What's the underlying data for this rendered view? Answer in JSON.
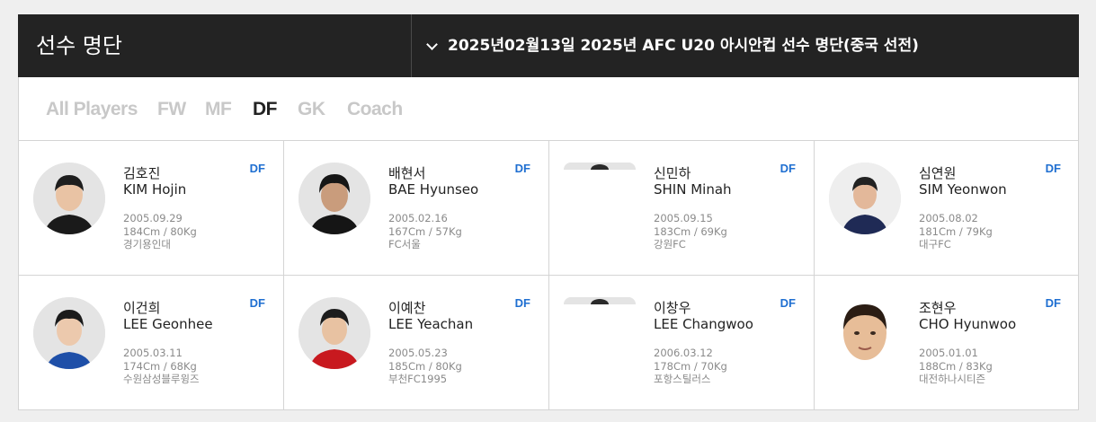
{
  "header": {
    "title": "선수 명단",
    "season": "2025년02월13일 2025년 AFC U20 아시안컵 선수 명단(중국 선전)"
  },
  "tabs": [
    "All Players",
    "FW",
    "MF",
    "DF",
    "GK",
    "Coach"
  ],
  "active_tab": "DF",
  "colors": {
    "header_bg": "#232323",
    "accent": "#1f6fd1",
    "inactive_tab": "#c8c8c8"
  },
  "players": [
    {
      "name_ko": "김호진",
      "name_en": "KIM Hojin",
      "position": "DF",
      "birth": "2005.09.29",
      "body": "184Cm / 80Kg",
      "team": "경기용인대"
    },
    {
      "name_ko": "배현서",
      "name_en": "BAE Hyunseo",
      "position": "DF",
      "birth": "2005.02.16",
      "body": "167Cm / 57Kg",
      "team": "FC서울"
    },
    {
      "name_ko": "신민하",
      "name_en": "SHIN Minah",
      "position": "DF",
      "birth": "2005.09.15",
      "body": "183Cm / 69Kg",
      "team": "강원FC"
    },
    {
      "name_ko": "심연원",
      "name_en": "SIM Yeonwon",
      "position": "DF",
      "birth": "2005.08.02",
      "body": "181Cm / 79Kg",
      "team": "대구FC"
    },
    {
      "name_ko": "이건희",
      "name_en": "LEE Geonhee",
      "position": "DF",
      "birth": "2005.03.11",
      "body": "174Cm / 68Kg",
      "team": "수원삼성블루윙즈"
    },
    {
      "name_ko": "이예찬",
      "name_en": "LEE Yeachan",
      "position": "DF",
      "birth": "2005.05.23",
      "body": "185Cm / 80Kg",
      "team": "부천FC1995"
    },
    {
      "name_ko": "이창우",
      "name_en": "LEE Changwoo",
      "position": "DF",
      "birth": "2006.03.12",
      "body": "178Cm / 70Kg",
      "team": "포항스틸러스"
    },
    {
      "name_ko": "조현우",
      "name_en": "CHO Hyunwoo",
      "position": "DF",
      "birth": "2005.01.01",
      "body": "188Cm / 83Kg",
      "team": "대전하나시티즌"
    }
  ]
}
